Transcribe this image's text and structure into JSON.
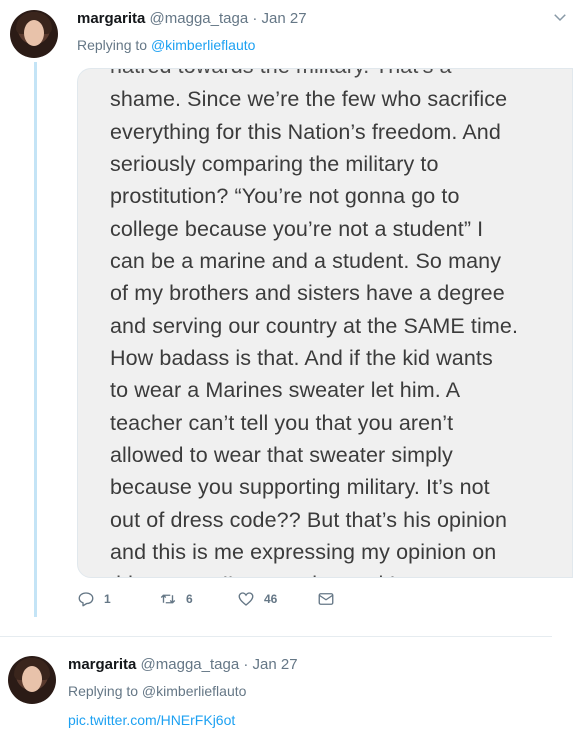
{
  "tweets": [
    {
      "display_name": "margarita",
      "handle": "@magga_taga",
      "separator": "·",
      "date": "Jan 27",
      "replying_prefix": "Replying to ",
      "replying_to": "@kimberlieflauto",
      "image_text_lines": [
        "hatred towards the military. That's a",
        "shame. Since we’re the few who sacrifice",
        "everything for this Nation’s freedom. And",
        "seriously comparing the military to",
        "prostitution? “You’re not gonna go to",
        "college because you’re not a student” I",
        "can be a marine and a student. So many",
        "of my brothers and sisters have a degree",
        "and serving our country at the SAME time.",
        "How badass is that. And if the kid wants",
        "to wear a Marines sweater let him. A",
        "teacher can’t tell you that you aren’t",
        "allowed to wear that sweater simply",
        "because you supporting military. It’s not",
        "out of dress code?? But that’s his opinion",
        "and this is me expressing my opinion on",
        "this matter. I'm a marine and I support"
      ],
      "actions": {
        "reply_count": "1",
        "retweet_count": "6",
        "like_count": "46"
      }
    },
    {
      "display_name": "margarita",
      "handle": "@magga_taga",
      "separator": "·",
      "date": "Jan 27",
      "replying_prefix": "Replying to @kimberlieflauto",
      "link": "pic.twitter.com/HNErFKj6ot"
    }
  ],
  "icons": [
    "reply-icon",
    "retweet-icon",
    "like-icon",
    "direct-message-icon",
    "chevron-down-icon"
  ],
  "colors": {
    "accent": "#1da1f2",
    "muted": "#657786",
    "thread_line": "#c4e4f6"
  }
}
